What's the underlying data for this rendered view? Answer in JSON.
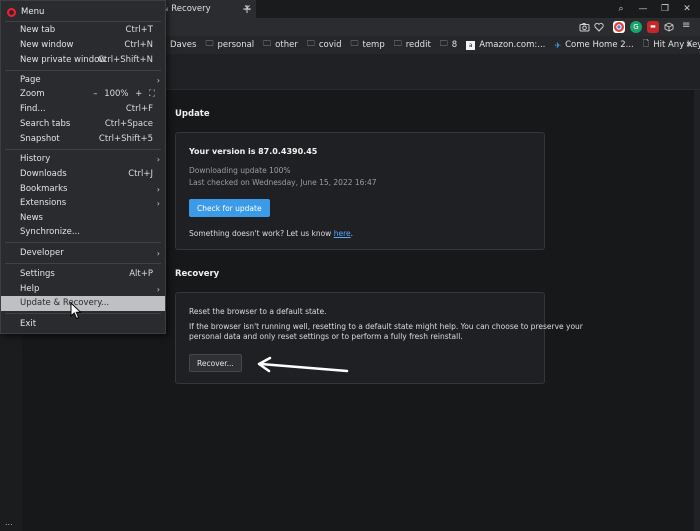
{
  "tab": {
    "title": "e & Recovery",
    "close": "✕",
    "new_tab": "+"
  },
  "window_controls": {
    "search": "⌕",
    "minimize": "—",
    "restore": "❐",
    "close": "✕"
  },
  "bookmarks": {
    "items": [
      {
        "label": "Daves",
        "icon": "none"
      },
      {
        "label": "personal",
        "icon": "folder-icon"
      },
      {
        "label": "other",
        "icon": "folder-icon"
      },
      {
        "label": "covid",
        "icon": "folder-icon"
      },
      {
        "label": "temp",
        "icon": "folder-icon"
      },
      {
        "label": "reddit",
        "icon": "folder-icon"
      },
      {
        "label": "8",
        "icon": "folder-icon"
      },
      {
        "label": "Amazon.com:...",
        "icon": "amazon-icon"
      },
      {
        "label": "Come Home 2...",
        "icon": "plane-icon"
      },
      {
        "label": "Hit Any Key...",
        "icon": "page-icon"
      }
    ],
    "more": "»"
  },
  "menu": {
    "title": "Menu",
    "items": {
      "new_tab": {
        "label": "New tab",
        "shortcut": "Ctrl+T"
      },
      "new_window": {
        "label": "New window",
        "shortcut": "Ctrl+N"
      },
      "new_private": {
        "label": "New private window",
        "shortcut": "Ctrl+Shift+N"
      },
      "page": {
        "label": "Page"
      },
      "zoom": {
        "label": "Zoom",
        "minus": "–",
        "value": "100%",
        "plus": "+",
        "fullscreen": "⛶"
      },
      "find": {
        "label": "Find...",
        "shortcut": "Ctrl+F"
      },
      "search_tabs": {
        "label": "Search tabs",
        "shortcut": "Ctrl+Space"
      },
      "snapshot": {
        "label": "Snapshot",
        "shortcut": "Ctrl+Shift+5"
      },
      "history": {
        "label": "History"
      },
      "downloads": {
        "label": "Downloads",
        "shortcut": "Ctrl+J"
      },
      "bookmarks": {
        "label": "Bookmarks"
      },
      "extensions": {
        "label": "Extensions"
      },
      "news": {
        "label": "News"
      },
      "synchronize": {
        "label": "Synchronize..."
      },
      "developer": {
        "label": "Developer"
      },
      "settings": {
        "label": "Settings",
        "shortcut": "Alt+P"
      },
      "help": {
        "label": "Help"
      },
      "update_recovery": {
        "label": "Update & Recovery..."
      },
      "exit": {
        "label": "Exit"
      }
    }
  },
  "update": {
    "section_title": "Update",
    "version_label": "Your version is",
    "version": "87.0.4390.45",
    "status": "Downloading update 100%",
    "last_checked": "Last checked on Wednesday, June 15, 2022 16:47",
    "check_button": "Check for update",
    "feedback_text": "Something doesn't work? Let us know",
    "feedback_link": "here",
    "feedback_end": "."
  },
  "recovery": {
    "section_title": "Recovery",
    "heading": "Reset the browser to a default state.",
    "description_1": "If the browser isn't running well, resetting to a default state might help. You can choose to preserve your",
    "description_2": "personal data and only reset settings or to perform a fully fresh reinstall.",
    "recover_button": "Recover..."
  },
  "sidebar": {
    "more": "..."
  },
  "colors": {
    "accent": "#3b9be8",
    "opera_red": "#ff1b2d",
    "link": "#5aa8ff",
    "menu_highlight": "#bfc0c4"
  }
}
